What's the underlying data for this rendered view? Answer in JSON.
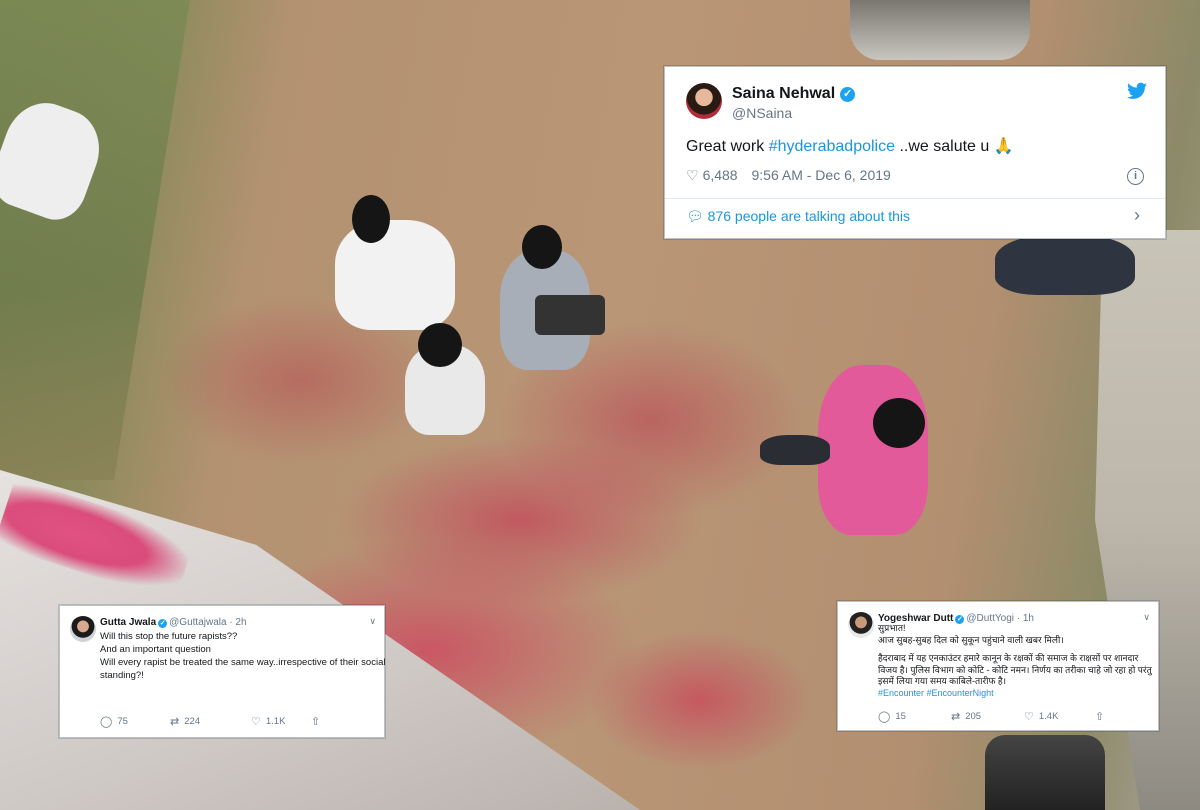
{
  "tweets": {
    "main": {
      "name": "Saina Nehwal",
      "handle": "@NSaina",
      "text_prefix": "Great work ",
      "hashtag": "#hyderabadpolice",
      "text_suffix": " ..we salute u 🙏",
      "likes": "6,488",
      "timestamp": "9:56 AM - Dec 6, 2019",
      "talking": "876 people are talking about this"
    },
    "gutta": {
      "name": "Gutta Jwala",
      "handle_time": "@Guttajwala · 2h",
      "lines": [
        "Will this stop the future rapists??",
        "And an important question",
        "Will every rapist be treated the same way..irrespective of their social",
        "standing?!"
      ],
      "replies": "75",
      "retweets": "224",
      "likes": "1.1K"
    },
    "yogeshwar": {
      "name": "Yogeshwar Dutt",
      "handle_time": "@DuttYogi · 1h",
      "lines": [
        "सुप्रभात!",
        "आज सुबह-सुबह दिल को सुकून पहुंचाने वाली खबर मिली।"
      ],
      "lines2": [
        "हैदराबाद में यह एनकाउंटर हमारे कानून के रक्षकों की समाज के राक्षसों पर शानदार",
        "विजय है। पुलिस विभाग को कोटि - कोटि नमन। निर्णय का तरीका चाहे जो रहा हो परंतु",
        "इसमें लिया गया समय काबिले-तारीफ है।"
      ],
      "hashtags": "#Encounter #EncounterNight",
      "replies": "15",
      "retweets": "205",
      "likes": "1.4K"
    }
  },
  "colors": {
    "twitter_blue": "#1da1f2",
    "link_blue": "#1b95e0",
    "muted": "#657786"
  },
  "icons": [
    "twitter-bird-icon",
    "verified-icon",
    "heart-icon",
    "info-icon",
    "comment-icon",
    "chevron-right-icon",
    "reply-icon",
    "retweet-icon",
    "share-icon",
    "caret-down-icon"
  ]
}
